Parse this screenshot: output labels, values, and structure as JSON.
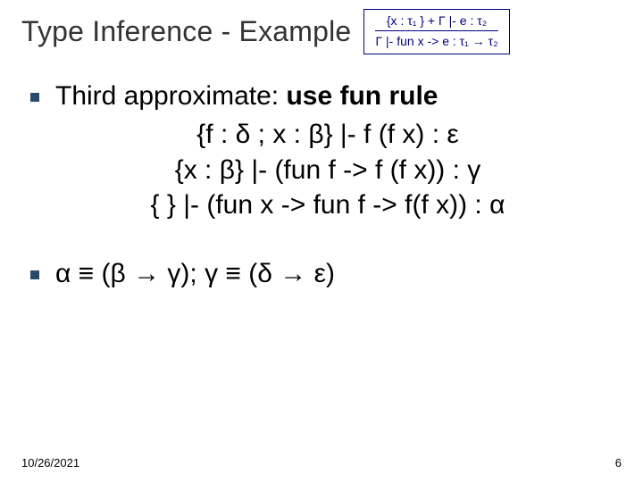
{
  "title": "Type Inference - Example",
  "rule": {
    "premise": "{x : τ₁ } + Γ |- e : τ₂",
    "conclusion": "Γ |- fun x -> e : τ₁ → τ₂"
  },
  "bullet1": {
    "lead_plain": "Third approximate: ",
    "lead_bold": "use fun rule",
    "lines": [
      "{f : δ ; x : β} |- f (f x) : ε",
      "{x : β} |- (fun f -> f (f x)) : γ",
      "{ } |- (fun x -> fun f -> f(f x)) : α"
    ]
  },
  "bullet2": {
    "text": "α ≡ (β → γ);  γ ≡ (δ → ε)"
  },
  "footer": {
    "date": "10/26/2021",
    "page": "6"
  }
}
